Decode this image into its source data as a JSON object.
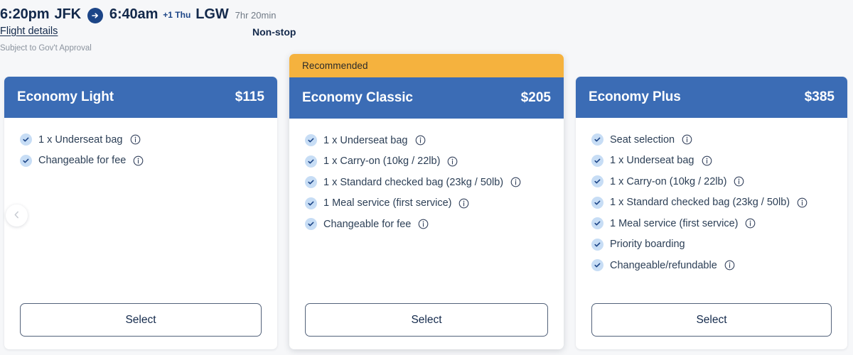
{
  "flight": {
    "depart_time": "6:20pm",
    "depart_airport": "JFK",
    "arrive_time": "6:40am",
    "day_offset": "+1 Thu",
    "arrive_airport": "LGW",
    "duration": "7hr 20min",
    "details_link": "Flight details",
    "stops": "Non-stop",
    "disclaimer": "Subject to Gov't Approval",
    "arrow_icon": "arrow-right-circle-icon"
  },
  "carousel": {
    "prev_label": "Previous fares",
    "prev_icon": "chevron-left-icon"
  },
  "icons": {
    "check": "check-circle-icon",
    "info": "info-circle-icon"
  },
  "colors": {
    "header_blue": "#3b6cb5",
    "recommended_amber": "#f5b23e",
    "page_background": "#f6f7f9",
    "text_navy": "#13294b"
  },
  "cards": [
    {
      "name": "Economy Light",
      "price": "$115",
      "badge": null,
      "select_label": "Select",
      "features": [
        {
          "label": "1 x Underseat bag",
          "info": true
        },
        {
          "label": "Changeable for fee",
          "info": true
        }
      ]
    },
    {
      "name": "Economy Classic",
      "price": "$205",
      "badge": "Recommended",
      "select_label": "Select",
      "features": [
        {
          "label": "1 x Underseat bag",
          "info": true
        },
        {
          "label": "1 x Carry-on (10kg / 22lb)",
          "info": true
        },
        {
          "label": "1 x Standard checked bag (23kg / 50lb)",
          "info": true
        },
        {
          "label": "1 Meal service (first service)",
          "info": true
        },
        {
          "label": "Changeable for fee",
          "info": true
        }
      ]
    },
    {
      "name": "Economy Plus",
      "price": "$385",
      "badge": null,
      "select_label": "Select",
      "features": [
        {
          "label": "Seat selection",
          "info": true
        },
        {
          "label": "1 x Underseat bag",
          "info": true
        },
        {
          "label": "1 x Carry-on (10kg / 22lb)",
          "info": true
        },
        {
          "label": "1 x Standard checked bag (23kg / 50lb)",
          "info": true
        },
        {
          "label": "1 Meal service (first service)",
          "info": true
        },
        {
          "label": "Priority boarding",
          "info": false
        },
        {
          "label": "Changeable/refundable",
          "info": true
        }
      ]
    }
  ]
}
